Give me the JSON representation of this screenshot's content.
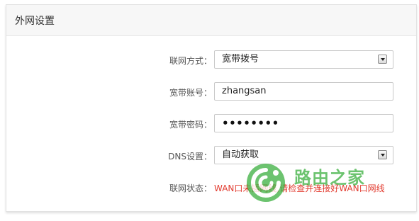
{
  "panel": {
    "title": "外网设置"
  },
  "form": {
    "connection_type": {
      "label": "联网方式：",
      "value": "宽带拨号"
    },
    "account": {
      "label": "宽带账号：",
      "value": "zhangsan"
    },
    "password": {
      "label": "宽带密码：",
      "value": "••••••••"
    },
    "dns": {
      "label": "DNS设置：",
      "value": "自动获取"
    },
    "status": {
      "label": "联网状态：",
      "value": "WAN口未插网线,请检查并连接好WAN口网线"
    }
  },
  "watermark": {
    "text": "路由之家",
    "icon": "router-home-logo-icon",
    "color": "#3caf3f"
  },
  "colors": {
    "status_error": "#e23b2f",
    "header_bg": "#f7f7f7"
  }
}
